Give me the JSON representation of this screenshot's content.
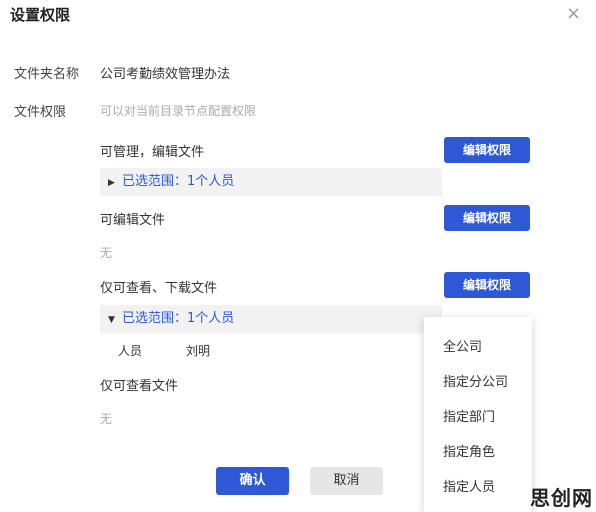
{
  "dialog": {
    "title": "设置权限",
    "close_icon": "×"
  },
  "folder": {
    "label": "文件夹名称",
    "name": "公司考勤绩效管理办法"
  },
  "permissions": {
    "label": "文件权限",
    "hint": "可以对当前目录节点配置权限",
    "sections": [
      {
        "title": "可管理，编辑文件",
        "button": "编辑权限",
        "range": "已选范围：1个人员",
        "expanded": false
      },
      {
        "title": "可编辑文件",
        "button": "编辑权限",
        "none_text": "无"
      },
      {
        "title": "仅可查看、下载文件",
        "button": "编辑权限",
        "range": "已选范围：1个人员",
        "expanded": true,
        "member_label": "人员",
        "member_name": "刘明"
      },
      {
        "title": "仅可查看文件",
        "none_text": "无"
      }
    ]
  },
  "dropdown": {
    "items": [
      "全公司",
      "指定分公司",
      "指定部门",
      "指定角色",
      "指定人员"
    ]
  },
  "footer": {
    "confirm": "确认",
    "cancel": "取消"
  },
  "watermark": "思创网",
  "colors": {
    "primary": "#2d59d6",
    "range_bg": "#f2f2f2",
    "hint": "#aaaaaa"
  }
}
